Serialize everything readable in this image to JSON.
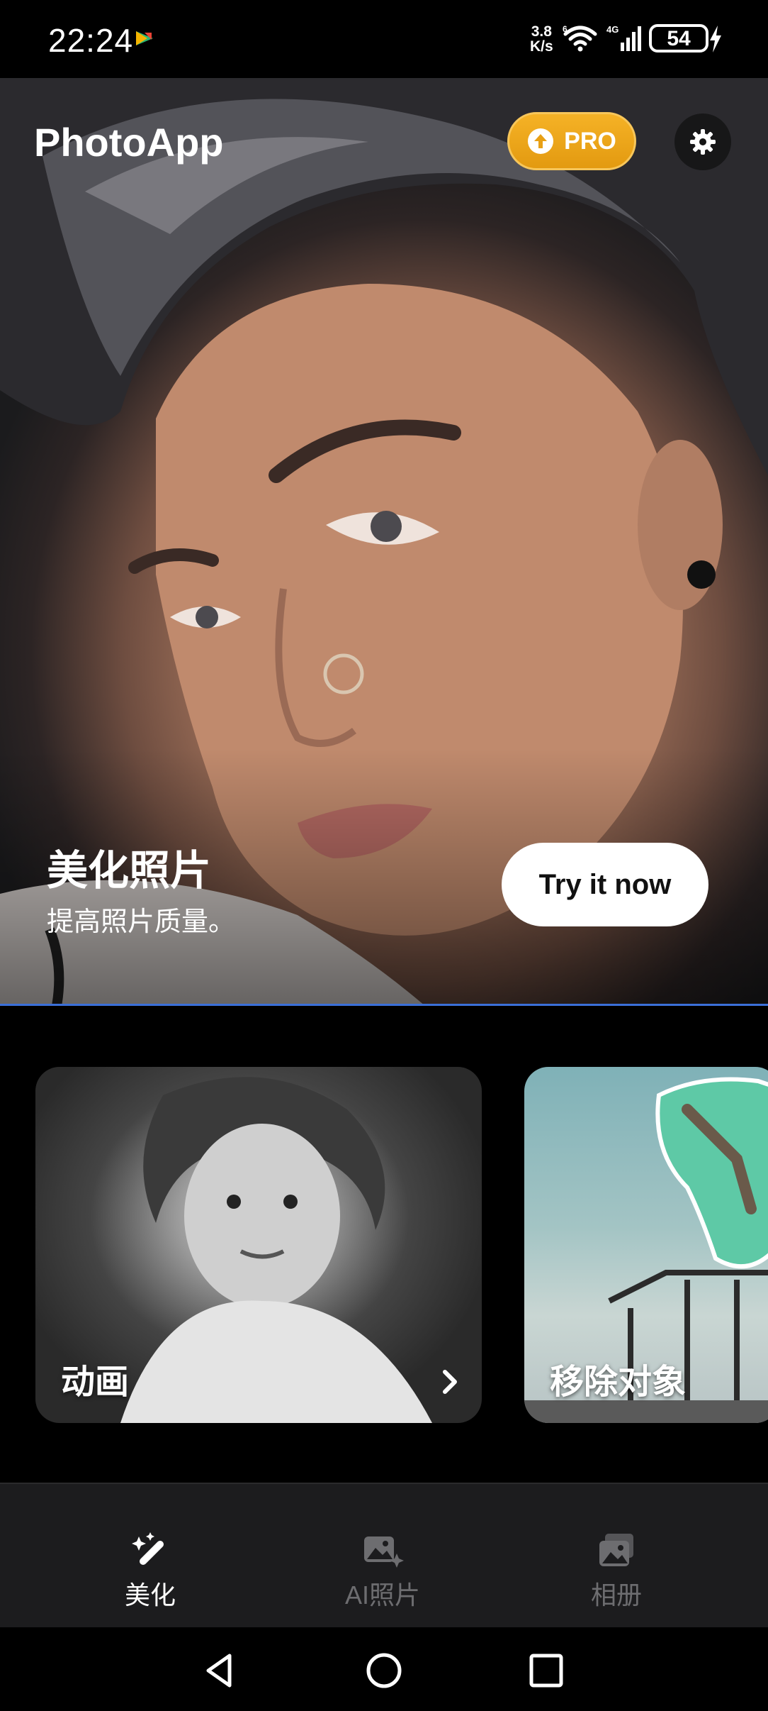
{
  "status_bar": {
    "time": "22:24",
    "speed_top": "3.8",
    "speed_bottom": "K/s",
    "wifi_badge": "6",
    "network": "4G",
    "battery": "54"
  },
  "header": {
    "app_title": "PhotoApp",
    "pro_label": "PRO"
  },
  "hero": {
    "title": "美化照片",
    "subtitle": "提高照片质量。",
    "cta_label": "Try it now"
  },
  "cards": [
    {
      "label": "动画"
    },
    {
      "label": "移除对象"
    }
  ],
  "bottom_nav": {
    "items": [
      {
        "label": "美化",
        "icon": "magic-wand-icon",
        "active": true
      },
      {
        "label": "AI照片",
        "icon": "ai-photo-icon",
        "active": false
      },
      {
        "label": "相册",
        "icon": "album-icon",
        "active": false
      }
    ]
  },
  "colors": {
    "accent_pro": "#f0a81c",
    "nav_active": "#ffffff",
    "nav_inactive": "#6d6d70",
    "hero_divider": "#3b6fd8"
  }
}
